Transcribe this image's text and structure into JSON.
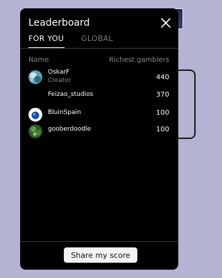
{
  "panel": {
    "title": "Leaderboard",
    "tabs": [
      {
        "label": "FOR YOU",
        "active": true
      },
      {
        "label": "GLOBAL",
        "active": false
      }
    ],
    "columns": {
      "name": "Name",
      "score": "Richest gamblers"
    },
    "rows": [
      {
        "name": "OskarF",
        "subtitle": "Creator",
        "score": "440",
        "avatar": "landscape-avatar"
      },
      {
        "name": "Feizao_studios",
        "score": "370",
        "avatar": "none"
      },
      {
        "name": "BluinSpain",
        "score": "100",
        "avatar": "blue-ball-avatar"
      },
      {
        "name": "gooberdoodle",
        "score": "100",
        "avatar": "green-avatar"
      }
    ],
    "share_label": "Share my score"
  },
  "icons": {
    "close": "close-icon"
  },
  "colors": {
    "background": "#b2b4d2",
    "panel": "#000000",
    "muted_text": "#8a8a8a",
    "button": "#f3f3f3"
  }
}
